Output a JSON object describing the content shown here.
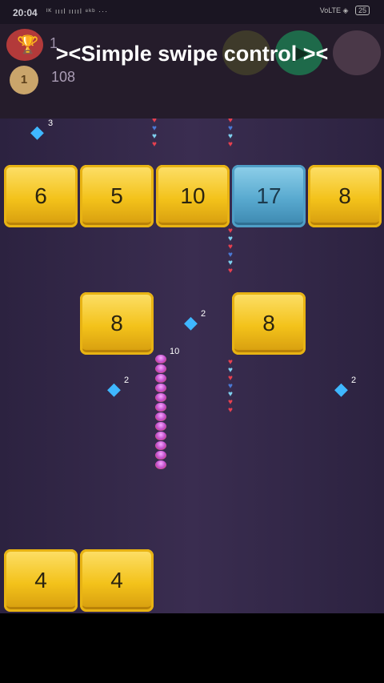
{
  "status": {
    "time": "20:04",
    "signal_text": "ᴵᴷ ıııl ııııl ⁸ᵏᵇ ···",
    "right_text": "VoLTE ◈",
    "battery": "25"
  },
  "hud": {
    "best": "1",
    "medal": "1",
    "score": "108",
    "trophy_icon": "trophy-icon",
    "play_icon": "▶"
  },
  "caption": "><Simple swipe control ><",
  "colors": {
    "gold": "#f3c21a",
    "blue_block": "#58a9cf",
    "gem": "#3fb7ff",
    "board": "#35294a"
  },
  "blocks": [
    {
      "value": "6"
    },
    {
      "value": "5"
    },
    {
      "value": "10"
    },
    {
      "value": "17"
    },
    {
      "value": "8"
    },
    {
      "value": "8"
    },
    {
      "value": "8"
    },
    {
      "value": "4"
    },
    {
      "value": "4"
    }
  ],
  "gems": [
    {
      "count": "3"
    },
    {
      "count": "2"
    },
    {
      "count": "2"
    },
    {
      "count": "2"
    }
  ],
  "balls": {
    "count": "10"
  }
}
